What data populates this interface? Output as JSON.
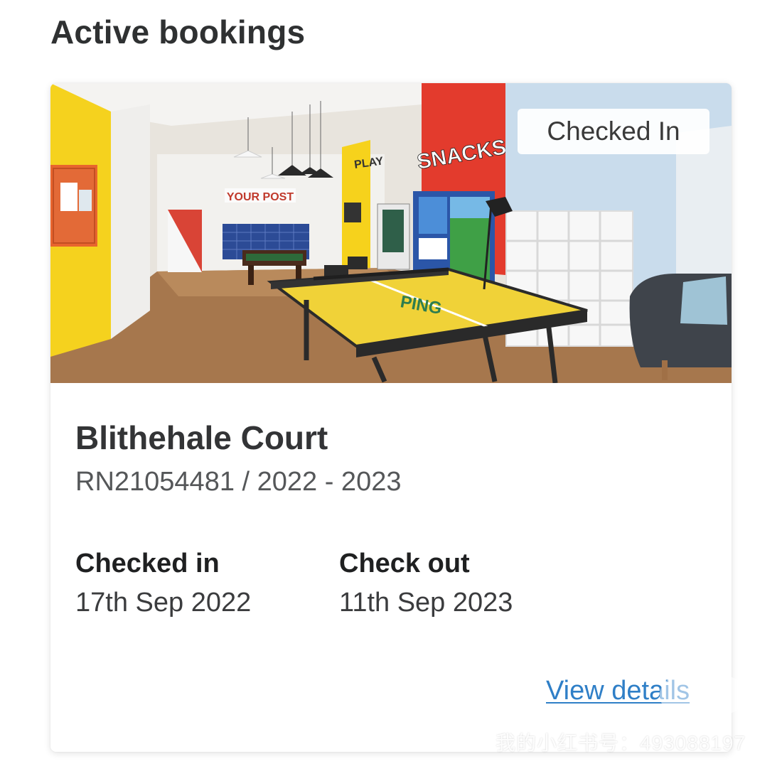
{
  "page": {
    "title": "Active bookings"
  },
  "booking": {
    "image_alt": "Common room with ping pong table, pool table, vending machines and mailboxes",
    "image_signs": {
      "your_post": "YOUR POST",
      "play": "PLAY",
      "snacks": "SNACKS",
      "ping": "PING"
    },
    "status": "Checked In",
    "property_name": "Blithehale Court",
    "reference": "RN21054481 / 2022 - 2023",
    "checked_in_label": "Checked in",
    "checked_in_date": "17th Sep 2022",
    "check_out_label": "Check out",
    "check_out_date": "11th Sep 2023",
    "view_details": "View details"
  },
  "watermark": {
    "text": "我的小红书号：493088197"
  },
  "colors": {
    "link": "#2f7fc7",
    "heading": "#2f3132",
    "text": "#3b3c3e"
  }
}
